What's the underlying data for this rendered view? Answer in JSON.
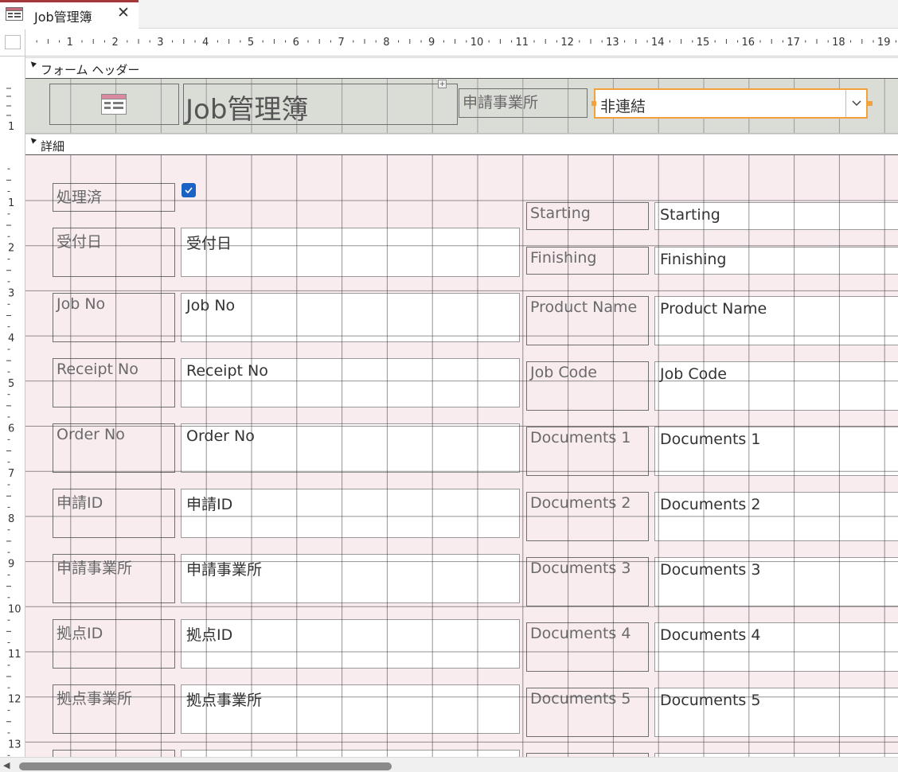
{
  "tab": {
    "title": "Job管理簿",
    "close_glyph": "✕",
    "icon": "form-icon"
  },
  "ruler": {
    "horizontal_labels": [
      "1",
      "2",
      "3",
      "4",
      "5",
      "6",
      "7",
      "8",
      "9",
      "10",
      "11",
      "12",
      "13",
      "14",
      "15",
      "16",
      "17",
      "18",
      "19"
    ],
    "vertical_labels": [
      "1",
      "1",
      "2",
      "3",
      "4",
      "5",
      "6",
      "7",
      "8",
      "9",
      "10",
      "11",
      "12",
      "13"
    ]
  },
  "sections": {
    "form_header": "フォーム ヘッダー",
    "detail": "詳細"
  },
  "header": {
    "title": "Job管理簿",
    "logo_icon": "form-icon",
    "office_label": "申請事業所",
    "office_combo_value": "非連結"
  },
  "detail": {
    "left": [
      {
        "label": "処理済",
        "kind": "checkbox",
        "checked": true
      },
      {
        "label": "受付日",
        "value": "受付日"
      },
      {
        "label": "Job No",
        "value": "Job No"
      },
      {
        "label": "Receipt No",
        "value": "Receipt No"
      },
      {
        "label": "Order No",
        "value": "Order No"
      },
      {
        "label": "申請ID",
        "value": "申請ID"
      },
      {
        "label": "申請事業所",
        "value": "申請事業所"
      },
      {
        "label": "拠点ID",
        "value": "拠点ID"
      },
      {
        "label": "拠点事業所",
        "value": "拠点事業所"
      }
    ],
    "right": [
      {
        "label": "Starting",
        "value": "Starting"
      },
      {
        "label": "Finishing",
        "value": "Finishing"
      },
      {
        "label": "Product Name",
        "value": "Product Name"
      },
      {
        "label": "Job Code",
        "value": "Job Code"
      },
      {
        "label": "Documents 1",
        "value": "Documents 1"
      },
      {
        "label": "Documents 2",
        "value": "Documents 2"
      },
      {
        "label": "Documents 3",
        "value": "Documents 3"
      },
      {
        "label": "Documents 4",
        "value": "Documents 4"
      },
      {
        "label": "Documents 5",
        "value": "Documents 5"
      }
    ]
  },
  "colors": {
    "accent": "#f3a23b",
    "tab_accent": "#a4373a",
    "detail_bg": "#f8ecef",
    "header_bg": "#dadcd6",
    "checkbox": "#1a63c4"
  }
}
